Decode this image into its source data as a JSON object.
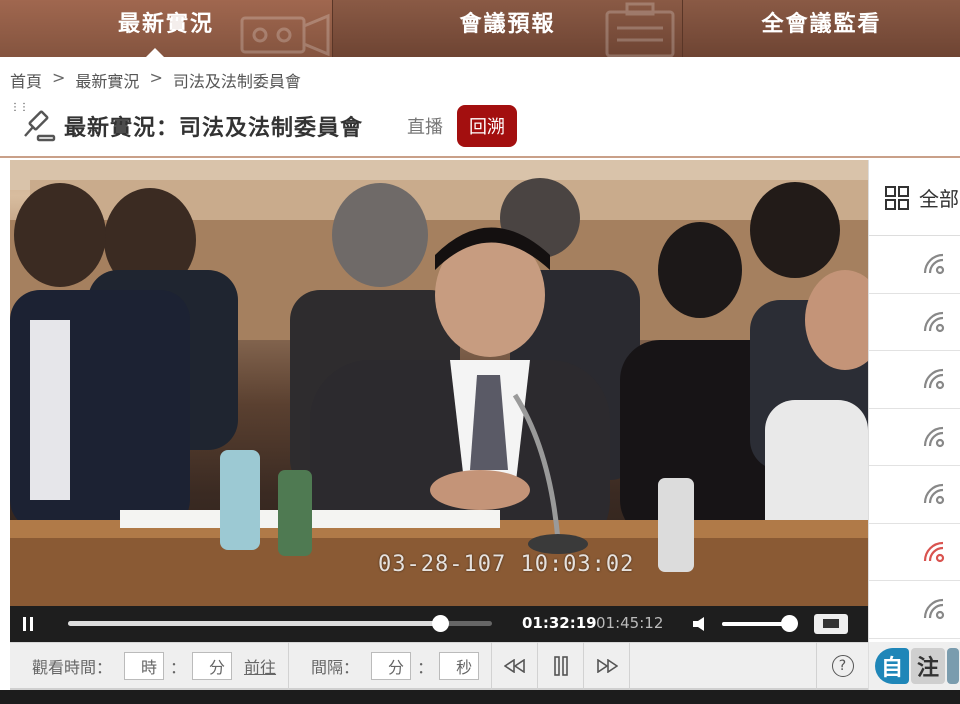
{
  "nav": {
    "tabs": [
      {
        "label": "最新實況",
        "active": true
      },
      {
        "label": "會議預報",
        "active": false
      },
      {
        "label": "全會議監看",
        "active": false
      }
    ]
  },
  "breadcrumb": {
    "home": "首頁",
    "sep": ">",
    "level1": "最新實況",
    "level2": "司法及法制委員會"
  },
  "title": {
    "text": "最新實況：司法及法制委員會",
    "live_label": "直播",
    "replay_label": "回溯"
  },
  "video": {
    "overlay_timestamp": "03-28-107  10:03:02"
  },
  "player": {
    "current_time": "01:32:19",
    "duration": "01:45:12",
    "progress_fraction": 0.877,
    "volume_fraction": 0.95
  },
  "toolbar": {
    "watch_time_label": "觀看時間：",
    "hour_placeholder": "時",
    "minute_placeholder": "分",
    "go_label": "前往",
    "interval_label": "間隔：",
    "interval_minute_placeholder": "分",
    "interval_second_placeholder": "秒",
    "colon": "：",
    "help": "?"
  },
  "side_panel": {
    "header_label": "全部",
    "items": [
      {
        "status": "normal"
      },
      {
        "status": "normal"
      },
      {
        "status": "normal"
      },
      {
        "status": "normal"
      },
      {
        "status": "normal"
      },
      {
        "status": "live"
      },
      {
        "status": "normal"
      }
    ],
    "footer_tags": [
      "自",
      "注"
    ]
  },
  "colors": {
    "nav_bg": "#7a4c39",
    "replay_red": "#a30f0f",
    "live_icon_red": "#d9534f",
    "broadcast_icon_gray": "#888888"
  }
}
